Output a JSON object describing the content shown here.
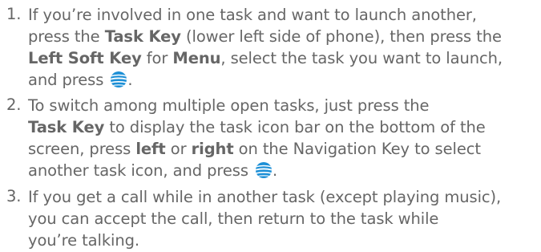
{
  "items": [
    {
      "number": "1.",
      "lines": [
        [
          "If you’re involved in one task and want to launch another,"
        ],
        [
          "press the ",
          {
            "b": "Task Key"
          },
          " (lower left side of phone), then press the"
        ],
        [
          {
            "b": "Left Soft Key"
          },
          " for ",
          {
            "b": "Menu"
          },
          ", select the task you want to launch,"
        ],
        [
          "and press ",
          {
            "icon": "att-globe-icon"
          },
          "."
        ]
      ]
    },
    {
      "number": "2.",
      "lines": [
        [
          "To switch among multiple open tasks, just press the"
        ],
        [
          {
            "b": "Task Key"
          },
          " to display the task icon bar on the bottom of the"
        ],
        [
          "screen, press ",
          {
            "b": "left"
          },
          " or ",
          {
            "b": "right"
          },
          " on the Navigation Key to select"
        ],
        [
          "another task icon, and press ",
          {
            "icon": "att-globe-icon"
          },
          "."
        ]
      ]
    },
    {
      "number": "3.",
      "lines": [
        [
          "If you get a call while in another task (except playing music),"
        ],
        [
          "you can accept the call, then return to the task while"
        ],
        [
          "you’re talking."
        ]
      ]
    }
  ],
  "colors": {
    "text": "#666666",
    "icon_blue": "#1c8fd6"
  }
}
